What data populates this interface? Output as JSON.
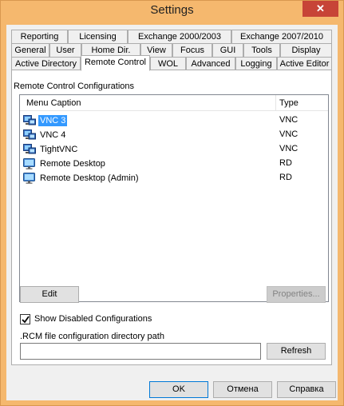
{
  "window": {
    "title": "Settings",
    "close_glyph": "✕"
  },
  "tabs": {
    "row1": [
      {
        "label": "Reporting"
      },
      {
        "label": "Licensing"
      },
      {
        "label": "Exchange 2000/2003"
      },
      {
        "label": "Exchange 2007/2010"
      }
    ],
    "row2": [
      {
        "label": "General"
      },
      {
        "label": "User"
      },
      {
        "label": "Home Dir."
      },
      {
        "label": "View"
      },
      {
        "label": "Focus"
      },
      {
        "label": "GUI"
      },
      {
        "label": "Tools"
      },
      {
        "label": "Display"
      }
    ],
    "row3": [
      {
        "label": "Active Directory"
      },
      {
        "label": "Remote Control",
        "active": true
      },
      {
        "label": "WOL"
      },
      {
        "label": "Advanced"
      },
      {
        "label": "Logging"
      },
      {
        "label": "Active Editor"
      }
    ]
  },
  "group": {
    "label": "Remote Control Configurations"
  },
  "list": {
    "columns": {
      "caption": "Menu Caption",
      "type": "Type"
    },
    "rows": [
      {
        "name": "VNC 3",
        "type": "VNC",
        "icon": "vnc-icon",
        "selected": true
      },
      {
        "name": "VNC 4",
        "type": "VNC",
        "icon": "vnc-icon"
      },
      {
        "name": "TightVNC",
        "type": "VNC",
        "icon": "vnc-icon"
      },
      {
        "name": "Remote Desktop",
        "type": "RD",
        "icon": "remote-desktop-icon"
      },
      {
        "name": "Remote Desktop (Admin)",
        "type": "RD",
        "icon": "remote-desktop-icon"
      }
    ]
  },
  "buttons": {
    "edit": "Edit",
    "properties": "Properties...",
    "refresh": "Refresh",
    "ok": "OK",
    "cancel": "Отмена",
    "help": "Справка"
  },
  "options": {
    "show_disabled_label": "Show Disabled Configurations",
    "show_disabled_checked": true
  },
  "rcm_path": {
    "label": ".RCM file configuration directory path",
    "value": ""
  },
  "colors": {
    "titlebar": "#f5b86e",
    "selection": "#3399ff",
    "close_button": "#c74437"
  }
}
